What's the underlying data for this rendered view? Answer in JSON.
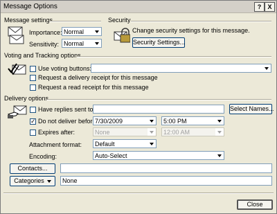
{
  "window": {
    "title": "Message Options",
    "help_label": "?",
    "close_label": "X"
  },
  "message_settings": {
    "heading": "Message settings",
    "importance_label": "Importance:",
    "importance_value": "Normal",
    "sensitivity_label": "Sensitivity:",
    "sensitivity_value": "Normal"
  },
  "security": {
    "heading": "Security",
    "description": "Change security settings for this message.",
    "button_label": "Security Settings..."
  },
  "voting": {
    "heading": "Voting and Tracking options",
    "use_voting_label": "Use voting buttons:",
    "use_voting_checked": false,
    "delivery_receipt_label": "Request a delivery receipt for this message",
    "delivery_receipt_checked": false,
    "read_receipt_label": "Request a read receipt for this message",
    "read_receipt_checked": false
  },
  "delivery": {
    "heading": "Delivery options",
    "replies_label": "Have replies sent to:",
    "replies_checked": false,
    "select_names_label": "Select Names...",
    "do_not_deliver_label": "Do not deliver before:",
    "do_not_deliver_checked": true,
    "deliver_date": "7/30/2009",
    "deliver_time": "5:00 PM",
    "expires_label": "Expires after:",
    "expires_checked": false,
    "expires_date": "None",
    "expires_time": "12:00 AM",
    "attachment_format_label": "Attachment format:",
    "attachment_format_value": "Default",
    "encoding_label": "Encoding:",
    "encoding_value": "Auto-Select"
  },
  "contacts": {
    "button_label": "Contacts...",
    "value": ""
  },
  "categories": {
    "button_label": "Categories",
    "value": "None"
  },
  "footer": {
    "close_label": "Close"
  },
  "icons": {
    "security": "padlock-envelope-icon",
    "voting": "checkmark-envelope-icon",
    "delivery": "envelope-hand-icon"
  },
  "colors": {
    "face": "#ece9d8",
    "field_border": "#7f9db9",
    "button_border": "#003c74"
  }
}
